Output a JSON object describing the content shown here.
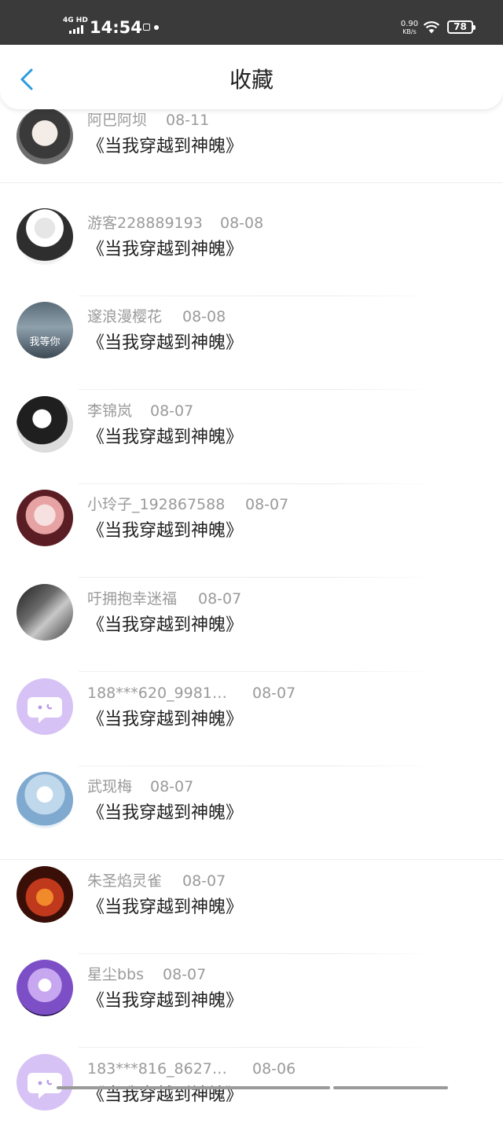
{
  "status_bar": {
    "network": "4G HD",
    "time": "14:54",
    "speed_value": "0.90",
    "speed_unit": "KB/s",
    "battery": "78"
  },
  "header": {
    "title": "收藏"
  },
  "colors": {
    "accent": "#2a9ae0",
    "meta_text": "#9a9a9a",
    "title_text": "#222222",
    "default_avatar": "#d6c2f5"
  },
  "items": [
    {
      "username": "阿巴阿坝",
      "date": "08-11",
      "title": "《当我穿越到神魄》",
      "avatar": "photo-avatar"
    },
    {
      "username": "游客228889193",
      "date": "08-08",
      "title": "《当我穿越到神魄》",
      "avatar": "photo-avatar"
    },
    {
      "username": "邃浪漫樱花",
      "date": "08-08",
      "title": "《当我穿越到神魄》",
      "avatar": "photo-avatar",
      "avatar_text": "我等你"
    },
    {
      "username": "李锦岚",
      "date": "08-07",
      "title": "《当我穿越到神魄》",
      "avatar": "photo-avatar"
    },
    {
      "username": "小玲子_192867588",
      "date": "08-07",
      "title": "《当我穿越到神魄》",
      "avatar": "photo-avatar"
    },
    {
      "username": "吁拥抱幸迷福",
      "date": "08-07",
      "title": "《当我穿越到神魄》",
      "avatar": "photo-avatar"
    },
    {
      "username": "188***620_9981…",
      "date": "08-07",
      "title": "《当我穿越到神魄》",
      "avatar": "default-chat-avatar"
    },
    {
      "username": "武现梅",
      "date": "08-07",
      "title": "《当我穿越到神魄》",
      "avatar": "photo-avatar"
    },
    {
      "username": "朱圣焰灵雀",
      "date": "08-07",
      "title": "《当我穿越到神魄》",
      "avatar": "photo-avatar"
    },
    {
      "username": "星尘bbs",
      "date": "08-07",
      "title": "《当我穿越到神魄》",
      "avatar": "photo-avatar"
    },
    {
      "username": "183***816_8627…",
      "date": "08-06",
      "title": "《当我穿越到神魄》",
      "avatar": "default-chat-avatar"
    }
  ]
}
